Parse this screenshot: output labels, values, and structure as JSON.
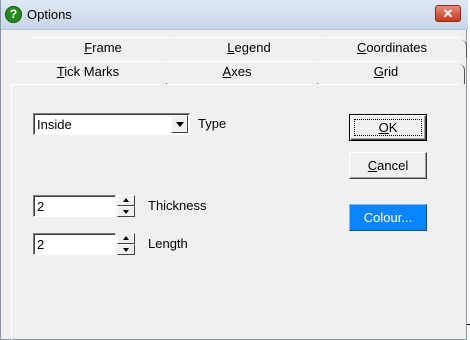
{
  "window": {
    "title": "Options",
    "app_icon": "help-question-icon",
    "close_icon": "close-icon"
  },
  "tabs": {
    "back_row": [
      {
        "label": "Frame",
        "underline": "F",
        "rest": "rame"
      },
      {
        "label": "Legend",
        "underline": "L",
        "rest": "egend"
      },
      {
        "label": "Coordinates",
        "underline": "C",
        "rest": "oordinates"
      }
    ],
    "front_row": [
      {
        "label": "Tick Marks",
        "underline": "T",
        "rest": "ick Marks",
        "selected": true
      },
      {
        "label": "Axes",
        "underline": "A",
        "rest": "xes"
      },
      {
        "label": "Grid",
        "underline": "G",
        "rest": "rid"
      }
    ]
  },
  "type": {
    "value": "Inside",
    "label": "Type"
  },
  "thickness": {
    "value": "2",
    "label": "Thickness"
  },
  "length": {
    "value": "2",
    "label": "Length"
  },
  "buttons": {
    "ok": {
      "underline": "O",
      "rest": "K"
    },
    "cancel": {
      "underline": "C",
      "rest": "ancel"
    },
    "colour": "Colour..."
  },
  "colors": {
    "colour_button": "#0a84ff",
    "close_button": "#c5391c",
    "dialog_bg": "#f0f0f0"
  }
}
